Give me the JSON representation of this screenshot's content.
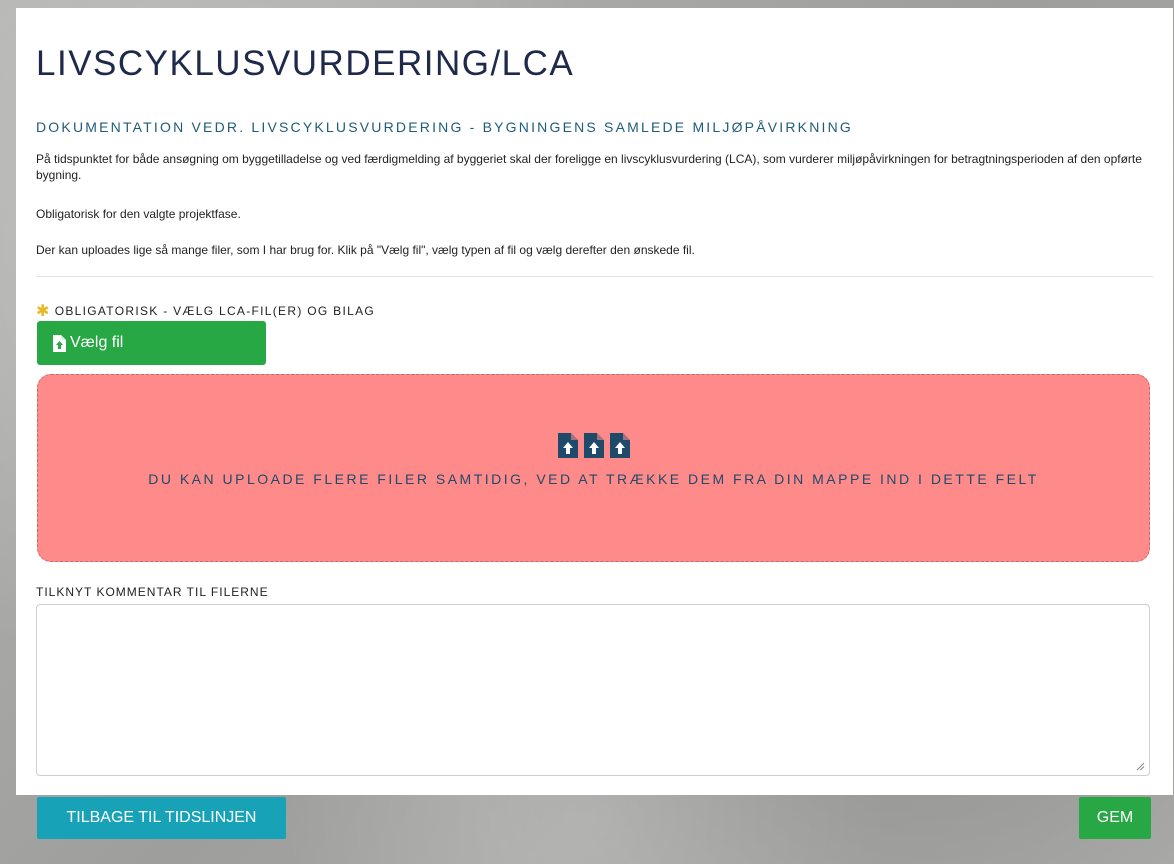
{
  "page": {
    "title": "LIVSCYKLUSVURDERING/LCA",
    "subtitle": "DOKUMENTATION VEDR. LIVSCYKLUSVURDERING - BYGNINGENS SAMLEDE MILJØPÅVIRKNING",
    "paragraphs": [
      "På tidspunktet for både ansøgning om byggetilladelse og ved færdigmelding af byggeriet skal der foreligge en livscyklusvurdering (LCA), som vurderer miljøpåvirkningen for betragtningsperioden af den opførte bygning.",
      "Obligatorisk for den valgte projektfase.",
      "Der kan uploades lige så mange filer, som I har brug for. Klik på \"Vælg fil\", vælg typen af fil og vælg derefter den ønskede fil."
    ]
  },
  "upload": {
    "required_label": "OBLIGATORISK - VÆLG LCA-FIL(ER) OG BILAG",
    "choose_button": "Vælg fil",
    "dropzone_text": "DU KAN UPLOADE FLERE FILER SAMTIDIG, VED AT TRÆKKE DEM FRA DIN MAPPE IND I DETTE FELT",
    "dropzone_icon": "file-upload-icon"
  },
  "comment": {
    "label": "TILKNYT KOMMENTAR TIL FILERNE",
    "value": ""
  },
  "footer": {
    "back_button": "TILBAGE TIL TIDSLINJEN",
    "save_button": "GEM"
  },
  "colors": {
    "primary_green": "#28a745",
    "info_blue": "#17a2b8",
    "dropzone_red": "#ff8a8a",
    "required_star": "#e8b923",
    "heading_navy": "#1f2a4a"
  }
}
